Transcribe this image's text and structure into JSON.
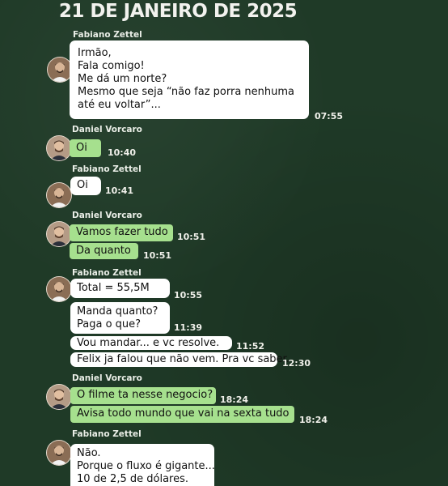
{
  "header": {
    "date_title": "21 DE JANEIRO DE 2025"
  },
  "senders": {
    "fabiano": "Fabiano Zettel",
    "daniel": "Daniel Vorcaro"
  },
  "messages": [
    {
      "text": "Irmão,\nFala comigo!\nMe dá um norte?\nMesmo que seja “não faz porra nenhuma\naté eu voltar”...",
      "time": "07:55"
    },
    {
      "text": "Oi",
      "time": "10:40"
    },
    {
      "text": "Oi",
      "time": "10:41"
    },
    {
      "text": "Vamos fazer tudo",
      "time": "10:51"
    },
    {
      "text": "Da quanto",
      "time": "10:51"
    },
    {
      "text": "Total = 55,5M",
      "time": "10:55"
    },
    {
      "text": "Manda quanto?\nPaga o que?",
      "time": "11:39"
    },
    {
      "text": "Vou mandar... e vc resolve.",
      "time": "11:52"
    },
    {
      "text": "Felix ja falou que não vem. Pra vc saber.",
      "time": "12:30"
    },
    {
      "text": "O filme ta nesse negocio?",
      "time": "18:24"
    },
    {
      "text": "Avisa todo mundo que vai na sexta tudo",
      "time": "18:24"
    },
    {
      "text": "Não.\nPorque o fluxo é gigante...\n10 de 2,5 de dólares."
    }
  ],
  "colors": {
    "background": "#1f3a27",
    "incoming_bubble": "#ffffff",
    "outgoing_bubble": "#a6e08e"
  },
  "icons": {
    "avatar_fabiano": "person-photo",
    "avatar_daniel": "person-photo"
  }
}
